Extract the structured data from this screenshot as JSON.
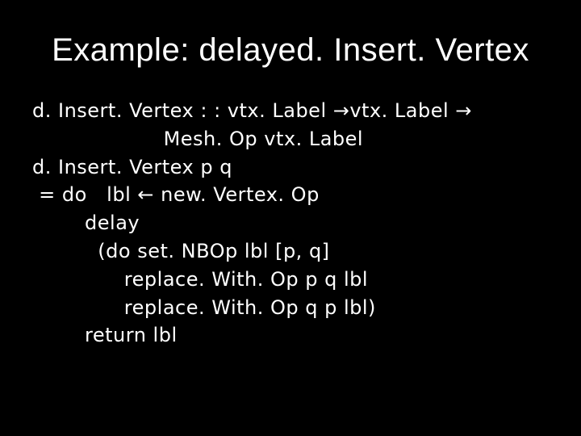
{
  "title": "Example: delayed. Insert. Vertex",
  "code": "d. Insert. Vertex : : vtx. Label →vtx. Label →\n                    Mesh. Op vtx. Label\nd. Insert. Vertex p q\n = do   lbl ← new. Vertex. Op\n        delay\n          (do set. NBOp lbl [p, q]\n              replace. With. Op p q lbl\n              replace. With. Op q p lbl)\n        return lbl"
}
